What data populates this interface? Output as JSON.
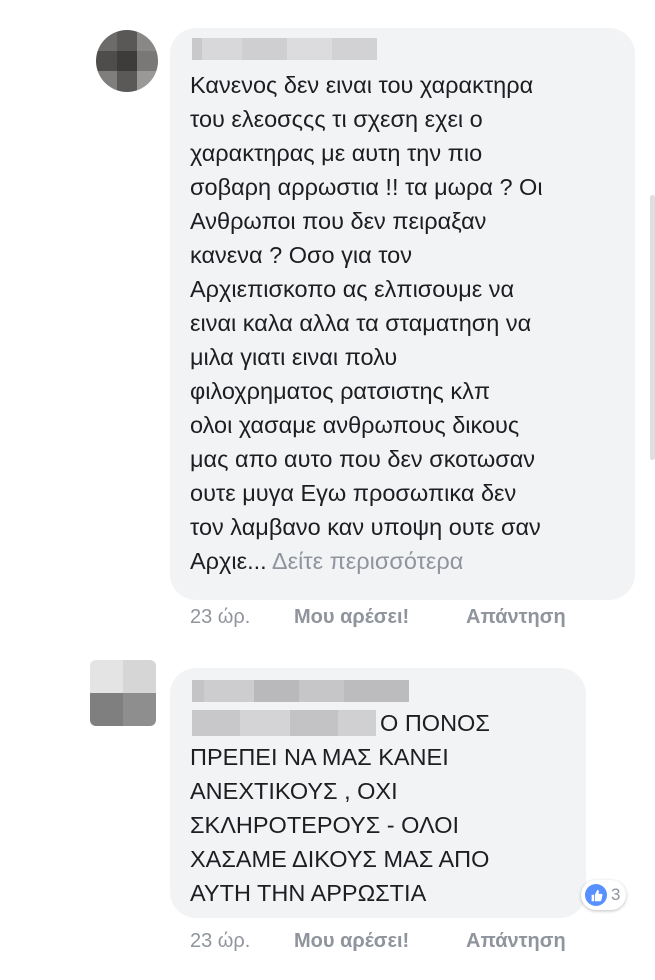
{
  "comments": [
    {
      "text": "Κανενος δεν ειναι του χαρακτηρα\nτου ελεοσςςς τι σχεση εχει ο\nχαρακτηρας με αυτη την πιο\nσοβαρη αρρωστια !! τα μωρα ? Οι\nΑνθρωποι που δεν πειραξαν\nκανενα ? Οσο για τον\nΑρχιεπισκοπο ας ελπισουμε να\nειναι καλα αλλα τα σταματηση να\nμιλα γιατι ειναι πολυ\nφιλοχρηματος ρατσιστης κλπ\nολοι χασαμε ανθρωπους δικους\nμας απο αυτο που δεν σκοτωσαν\nουτε μυγα Εγω προσωπικα δεν\nτον λαμβανο καν υποψη ουτε σαν\nΑρχιε...",
      "see_more": "Δείτε περισσότερα",
      "time": "23 ώρ.",
      "like_label": "Μου αρέσει!",
      "reply_label": "Απάντηση"
    },
    {
      "text_first_line": "ΠΟΝΟΣ",
      "text_rest": "ΠΡΕΠΕΙ ΝΑ ΜΑΣ ΚΑΝΕΙ\nΑΝΕΧΤΙΚΟΥΣ , ΟΧΙ\nΣΚΛΗΡΟΤΕΡΟΥΣ - ΟΛΟΙ\nΧΑΣΑΜΕ ΔΙΚΟΥΣ ΜΑΣ ΑΠΟ\nΑΥΤΗ ΤΗΝ ΑΡΡΩΣΤΙΑ",
      "text_prefix": "Ο",
      "reaction_count": "3",
      "time": "23 ώρ.",
      "like_label": "Μου αρέσει!",
      "reply_label": "Απάντηση"
    }
  ],
  "colors": {
    "bubble": "#f2f3f5",
    "meta": "#90949c",
    "like_blue": "#5890ff"
  },
  "icons": [
    "like-reaction-icon"
  ]
}
